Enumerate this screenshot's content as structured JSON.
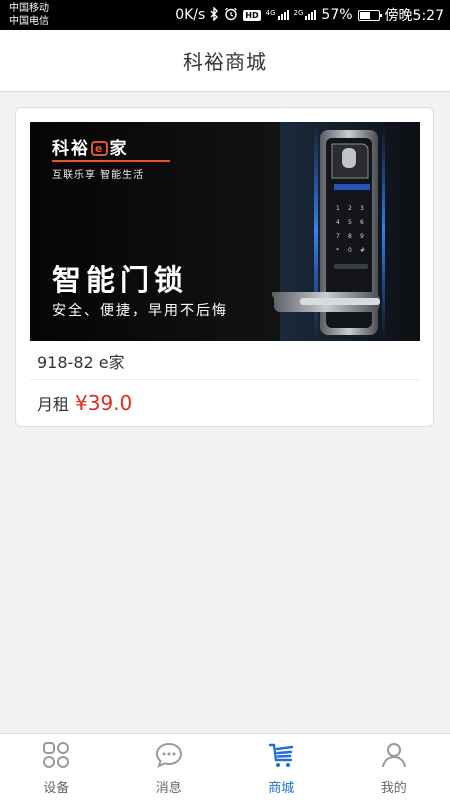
{
  "status_bar": {
    "carrier_1": "中国移动",
    "carrier_2": "中国电信",
    "network_speed": "0K/s",
    "hd_badge": "HD",
    "signal_1_tag": "4G",
    "signal_2_tag": "2G",
    "battery_percent": "57%",
    "battery_level": 0.57,
    "time": "傍晚5:27",
    "icons": [
      "bluetooth-icon",
      "alarm-icon",
      "signal-icon",
      "battery-icon"
    ]
  },
  "header": {
    "title": "科裕商城"
  },
  "product": {
    "banner": {
      "brand_prefix": "科裕",
      "brand_e": "e",
      "brand_suffix": "家",
      "slogan": "互联乐享 智能生活",
      "headline": "智能门锁",
      "subline": "安全、便捷，早用不后悔"
    },
    "name": "918-82 e家",
    "price_label": "月租",
    "price": "¥39.0"
  },
  "bottom_nav": {
    "items": [
      {
        "label": "设备",
        "icon": "devices-grid-icon",
        "active": false
      },
      {
        "label": "消息",
        "icon": "message-bubble-icon",
        "active": false
      },
      {
        "label": "商城",
        "icon": "shop-cart-icon",
        "active": true
      },
      {
        "label": "我的",
        "icon": "user-icon",
        "active": false
      }
    ]
  },
  "colors": {
    "accent_blue": "#1f6fd6",
    "price_red": "#e02b20",
    "brand_orange": "#e4572a",
    "inactive_icon": "#9a9a9a"
  }
}
